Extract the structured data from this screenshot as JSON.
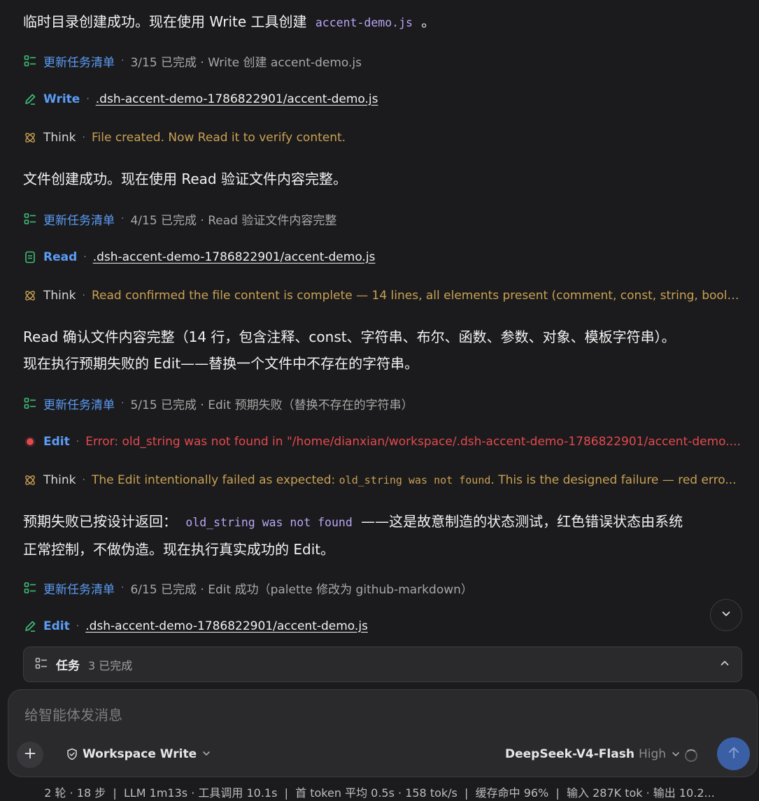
{
  "messages": {
    "p1_before": "临时目录创建成功。现在使用 Write 工具创建 ",
    "p1_code": "accent-demo.js",
    "p1_after": " 。",
    "p2": "文件创建成功。现在使用 Read 验证文件内容完整。",
    "p3_line1": "Read 确认文件内容完整（14 行，包含注释、const、字符串、布尔、函数、参数、对象、模板字符串）。",
    "p3_line2": "现在执行预期失败的 Edit——替换一个文件中不存在的字符串。",
    "p4_before": "预期失败已按设计返回： ",
    "p4_code": "old_string was not found",
    "p4_after": " ——这是故意制造的状态测试，红色错误状态由系统",
    "p4_line2": "正常控制，不做伪造。现在执行真实成功的 Edit。"
  },
  "steps": {
    "task1": {
      "label": "更新任务清单",
      "detail": "3/15 已完成 · Write 创建 accent-demo.js"
    },
    "write": {
      "label": "Write",
      "path": ".dsh-accent-demo-1786822901/accent-demo.js"
    },
    "think1": {
      "label": "Think",
      "text": "File created. Now Read it to verify content."
    },
    "task2": {
      "label": "更新任务清单",
      "detail": "4/15 已完成 · Read 验证文件内容完整"
    },
    "read": {
      "label": "Read",
      "path": ".dsh-accent-demo-1786822901/accent-demo.js"
    },
    "think2": {
      "label": "Think",
      "text": "Read confirmed the file content is complete — 14 lines, all elements present (comment, const, string, boole..."
    },
    "task3": {
      "label": "更新任务清单",
      "detail": "5/15 已完成 · Edit 预期失败（替换不存在的字符串）"
    },
    "edit_fail": {
      "label": "Edit",
      "error": "Error: old_string was not found in \"/home/dianxian/workspace/.dsh-accent-demo-1786822901/accent-demo...."
    },
    "think3": {
      "label": "Think",
      "text_before": "The Edit intentionally failed as expected: ",
      "text_code": "old_string was not found",
      "text_after": ". This is the designed failure — red erro..."
    },
    "task4": {
      "label": "更新任务清单",
      "detail": "6/15 已完成 · Edit 成功（palette 修改为 github-markdown）"
    },
    "edit_ok": {
      "label": "Edit",
      "path": ".dsh-accent-demo-1786822901/accent-demo.js"
    }
  },
  "taskbar": {
    "title": "任务",
    "count": "3 已完成"
  },
  "composer": {
    "placeholder": "给智能体发消息",
    "mode": "Workspace Write",
    "model": "DeepSeek-V4-Flash",
    "effort": "High"
  },
  "status": "2 轮 · 18 步  |  LLM 1m13s · 工具调用 10.1s  |  首 token 平均 0.5s · 158 tok/s  |  缓存命中 96%  |  输入 287K tok · 输出 10.2...",
  "colors": {
    "accent_blue": "#5b9cf5",
    "task_green": "#3ec07a",
    "think_gold": "#c9a052",
    "error_red": "#e5484d",
    "code_purple": "#b9a6f5"
  },
  "icons": [
    "checklist-icon",
    "pencil-icon",
    "atom-icon",
    "document-icon",
    "error-dot-icon",
    "chevron-down-icon",
    "chevron-up-icon",
    "plus-icon",
    "shield-icon",
    "arrow-up-icon"
  ]
}
